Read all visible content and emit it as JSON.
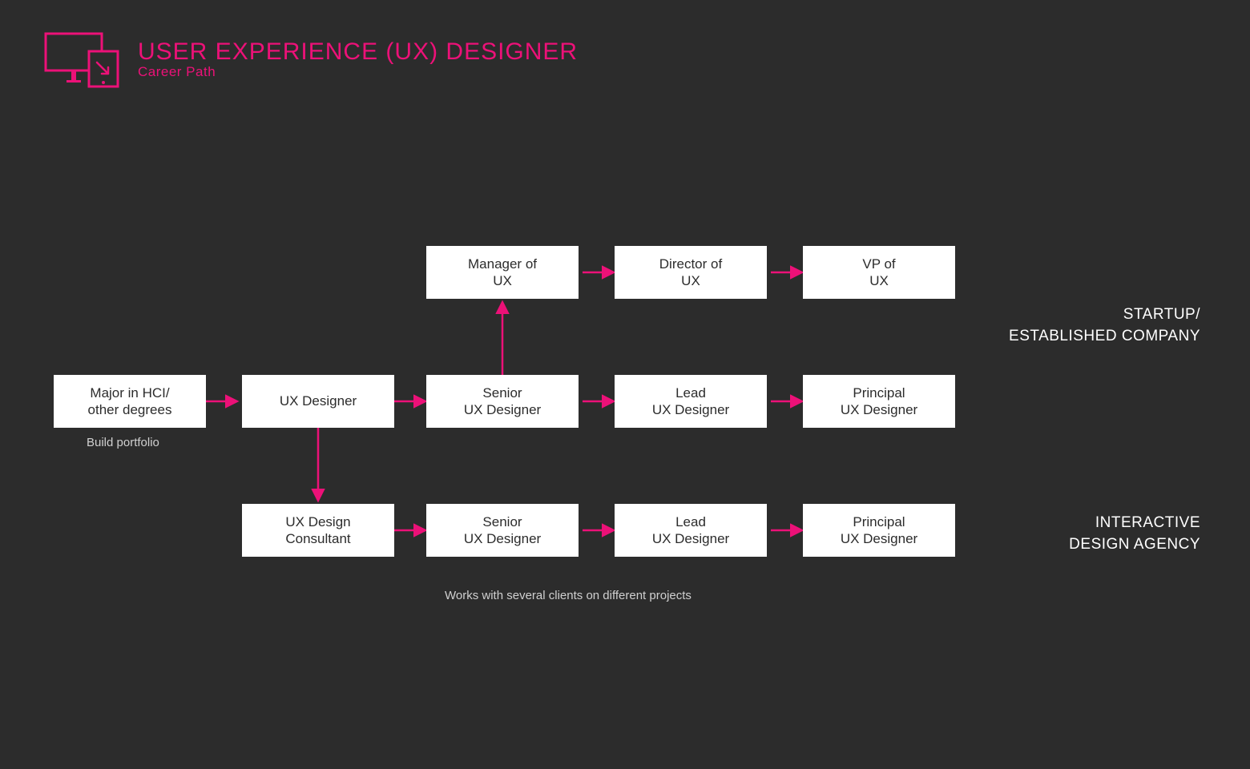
{
  "header": {
    "title": "USER EXPERIENCE (UX) DESIGNER",
    "subtitle": "Career Path"
  },
  "nodes": {
    "start": "Major in HCI/\nother degrees",
    "uxDesigner": "UX Designer",
    "senior": "Senior\nUX Designer",
    "lead": "Lead\nUX Designer",
    "principal": "Principal\nUX Designer",
    "manager": "Manager of\nUX",
    "director": "Director of\nUX",
    "vp": "VP of\nUX",
    "consultant": "UX Design\nConsultant",
    "senior2": "Senior\nUX Designer",
    "lead2": "Lead\nUX Designer",
    "principal2": "Principal\nUX Designer"
  },
  "captions": {
    "portfolio": "Build portfolio",
    "clients": "Works with several clients on different projects"
  },
  "tracks": {
    "startup_l1": "STARTUP/",
    "startup_l2": "ESTABLISHED COMPANY",
    "agency_l1": "INTERACTIVE",
    "agency_l2": "DESIGN AGENCY"
  },
  "colors": {
    "accent": "#ec1178",
    "bg": "#2c2c2c",
    "box": "#ffffff"
  }
}
